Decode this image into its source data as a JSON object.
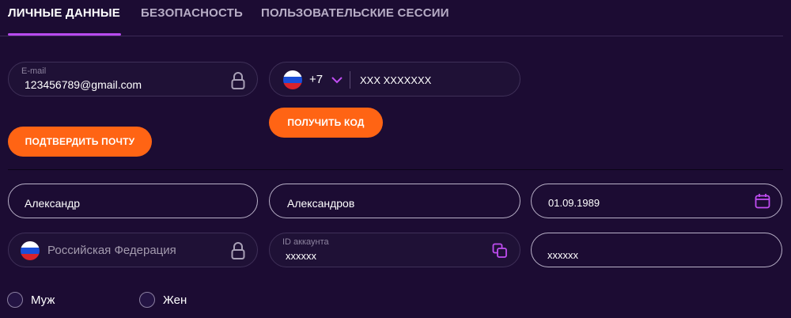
{
  "tabs": [
    {
      "label": "ЛИЧНЫЕ ДАННЫЕ",
      "active": true
    },
    {
      "label": "БЕЗОПАСНОСТЬ",
      "active": false
    },
    {
      "label": "ПОЛЬЗОВАТЕЛЬСКИЕ СЕССИИ",
      "active": false
    }
  ],
  "email": {
    "label": "E-mail",
    "value": "123456789@gmail.com",
    "icon": "lock-icon"
  },
  "phone": {
    "country_icon": "russia-flag-icon",
    "code": "+7",
    "value": "XXX XXXXXXX"
  },
  "buttons": {
    "confirm_email": "ПОДТВЕРДИТЬ ПОЧТУ",
    "get_code": "ПОЛУЧИТЬ КОД"
  },
  "first_name": {
    "value": "Александр"
  },
  "last_name": {
    "value": "Александров"
  },
  "birth_date": {
    "value": "01.09.1989",
    "icon": "calendar-icon"
  },
  "country": {
    "value": "Российская Федерация",
    "icon": "lock-icon"
  },
  "account_id": {
    "label": "ID аккаунта",
    "value": "xxxxxx",
    "icon": "copy-icon"
  },
  "extra_field": {
    "value": "xxxxxx"
  },
  "gender": {
    "options": [
      "Муж",
      "Жен"
    ]
  },
  "colors": {
    "accent": "#ff6414",
    "highlight": "#b84bf0",
    "background": "#1c0c33"
  }
}
